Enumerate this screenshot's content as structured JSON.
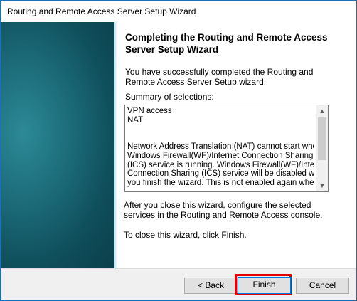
{
  "window": {
    "title": "Routing and Remote Access Server Setup Wizard"
  },
  "content": {
    "heading": "Completing the Routing and Remote Access Server Setup Wizard",
    "intro": "You have successfully completed the Routing and Remote Access Server Setup wizard.",
    "summary_label": "Summary of selections:",
    "summary_lines": [
      "VPN access",
      "NAT",
      "",
      "",
      "Network Address Translation (NAT) cannot start when",
      "Windows Firewall(WF)/Internet Connection Sharing",
      "(ICS) service is running. Windows Firewall(WF)/Internet",
      "Connection Sharing (ICS) service will be disabled when",
      "you finish the wizard. This is not enabled again when"
    ],
    "after_text": "After you close this wizard, configure the selected services in the Routing and  Remote Access console.",
    "close_text": "To close this wizard, click Finish."
  },
  "buttons": {
    "back": "< Back",
    "finish": "Finish",
    "cancel": "Cancel"
  },
  "icons": {
    "scroll_up": "▲",
    "scroll_down": "▼"
  }
}
